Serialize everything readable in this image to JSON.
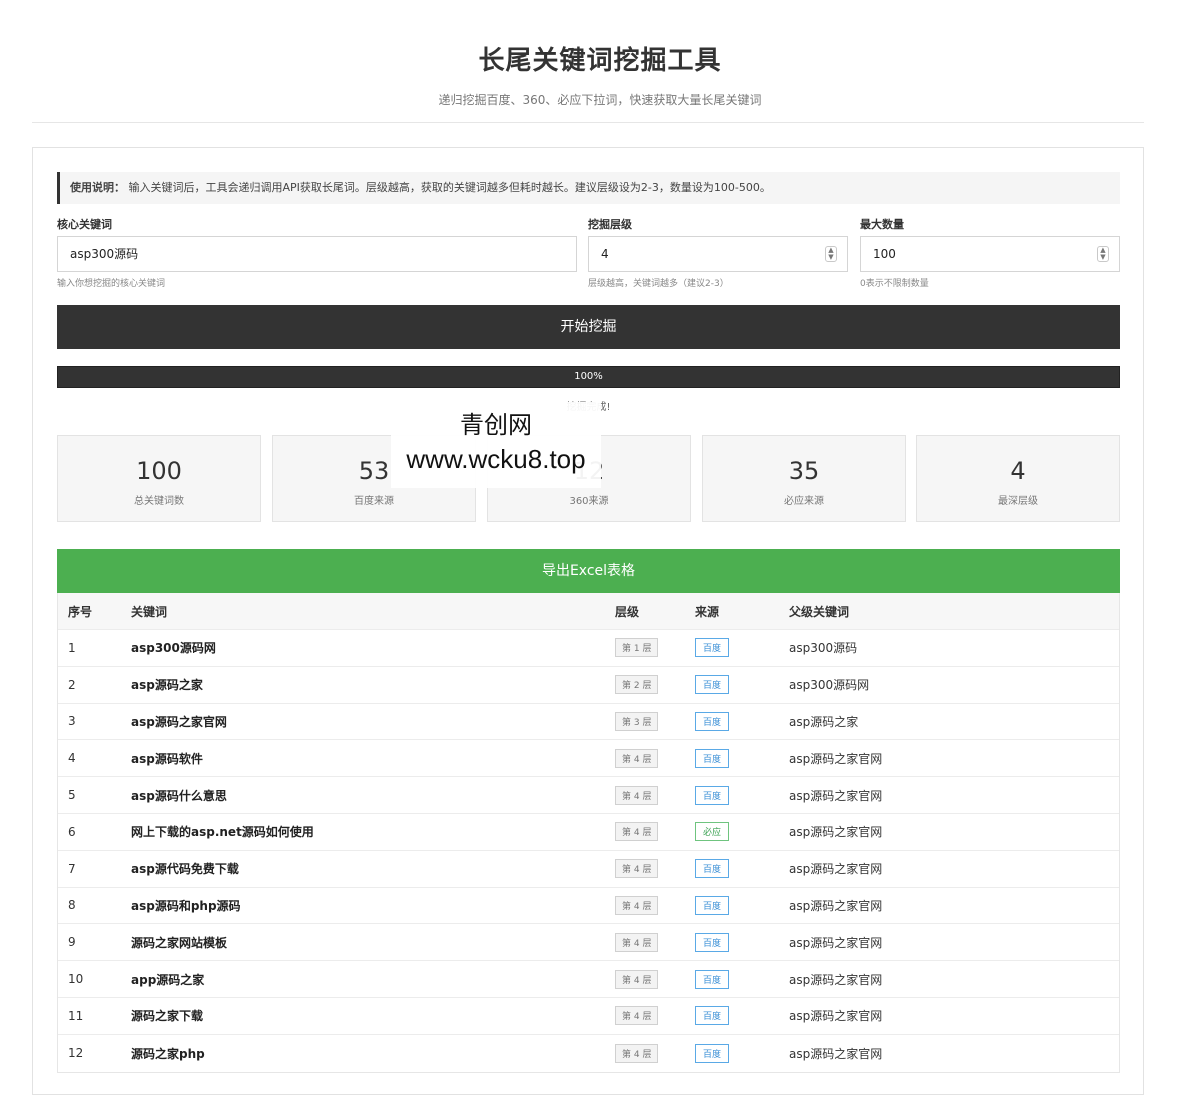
{
  "header": {
    "title": "长尾关键词挖掘工具",
    "subtitle": "递归挖掘百度、360、必应下拉词，快速获取大量长尾关键词"
  },
  "notice": {
    "label": "使用说明：",
    "text": "输入关键词后，工具会递归调用API获取长尾词。层级越高，获取的关键词越多但耗时越长。建议层级设为2-3，数量设为100-500。"
  },
  "form": {
    "keyword": {
      "label": "核心关键词",
      "value": "asp300源码",
      "hint": "输入你想挖掘的核心关键词"
    },
    "depth": {
      "label": "挖掘层级",
      "value": "4",
      "hint": "层级越高，关键词越多（建议2-3）"
    },
    "max": {
      "label": "最大数量",
      "value": "100",
      "hint": "0表示不限制数量"
    },
    "start_label": "开始挖掘"
  },
  "progress": {
    "percent": 100,
    "text": "100%",
    "status": "挖掘完成!"
  },
  "stats": [
    {
      "num": "100",
      "label": "总关键词数"
    },
    {
      "num": "53",
      "label": "百度来源"
    },
    {
      "num": "12",
      "label": "360来源"
    },
    {
      "num": "35",
      "label": "必应来源"
    },
    {
      "num": "4",
      "label": "最深层级"
    }
  ],
  "watermark": {
    "line1": "青创网",
    "line2": "www.wcku8.top"
  },
  "export_label": "导出Excel表格",
  "table": {
    "headers": [
      "序号",
      "关键词",
      "层级",
      "来源",
      "父级关键词"
    ],
    "rows": [
      {
        "idx": "1",
        "kw": "asp300源码网",
        "lvl": "第 1 层",
        "src": "百度",
        "parent": "asp300源码"
      },
      {
        "idx": "2",
        "kw": "asp源码之家",
        "lvl": "第 2 层",
        "src": "百度",
        "parent": "asp300源码网"
      },
      {
        "idx": "3",
        "kw": "asp源码之家官网",
        "lvl": "第 3 层",
        "src": "百度",
        "parent": "asp源码之家"
      },
      {
        "idx": "4",
        "kw": "asp源码软件",
        "lvl": "第 4 层",
        "src": "百度",
        "parent": "asp源码之家官网"
      },
      {
        "idx": "5",
        "kw": "asp源码什么意思",
        "lvl": "第 4 层",
        "src": "百度",
        "parent": "asp源码之家官网"
      },
      {
        "idx": "6",
        "kw": "网上下载的asp.net源码如何使用",
        "lvl": "第 4 层",
        "src": "必应",
        "parent": "asp源码之家官网"
      },
      {
        "idx": "7",
        "kw": "asp源代码免费下载",
        "lvl": "第 4 层",
        "src": "百度",
        "parent": "asp源码之家官网"
      },
      {
        "idx": "8",
        "kw": "asp源码和php源码",
        "lvl": "第 4 层",
        "src": "百度",
        "parent": "asp源码之家官网"
      },
      {
        "idx": "9",
        "kw": "源码之家网站模板",
        "lvl": "第 4 层",
        "src": "百度",
        "parent": "asp源码之家官网"
      },
      {
        "idx": "10",
        "kw": "app源码之家",
        "lvl": "第 4 层",
        "src": "百度",
        "parent": "asp源码之家官网"
      },
      {
        "idx": "11",
        "kw": "源码之家下载",
        "lvl": "第 4 层",
        "src": "百度",
        "parent": "asp源码之家官网"
      },
      {
        "idx": "12",
        "kw": "源码之家php",
        "lvl": "第 4 层",
        "src": "百度",
        "parent": "asp源码之家官网"
      }
    ]
  }
}
